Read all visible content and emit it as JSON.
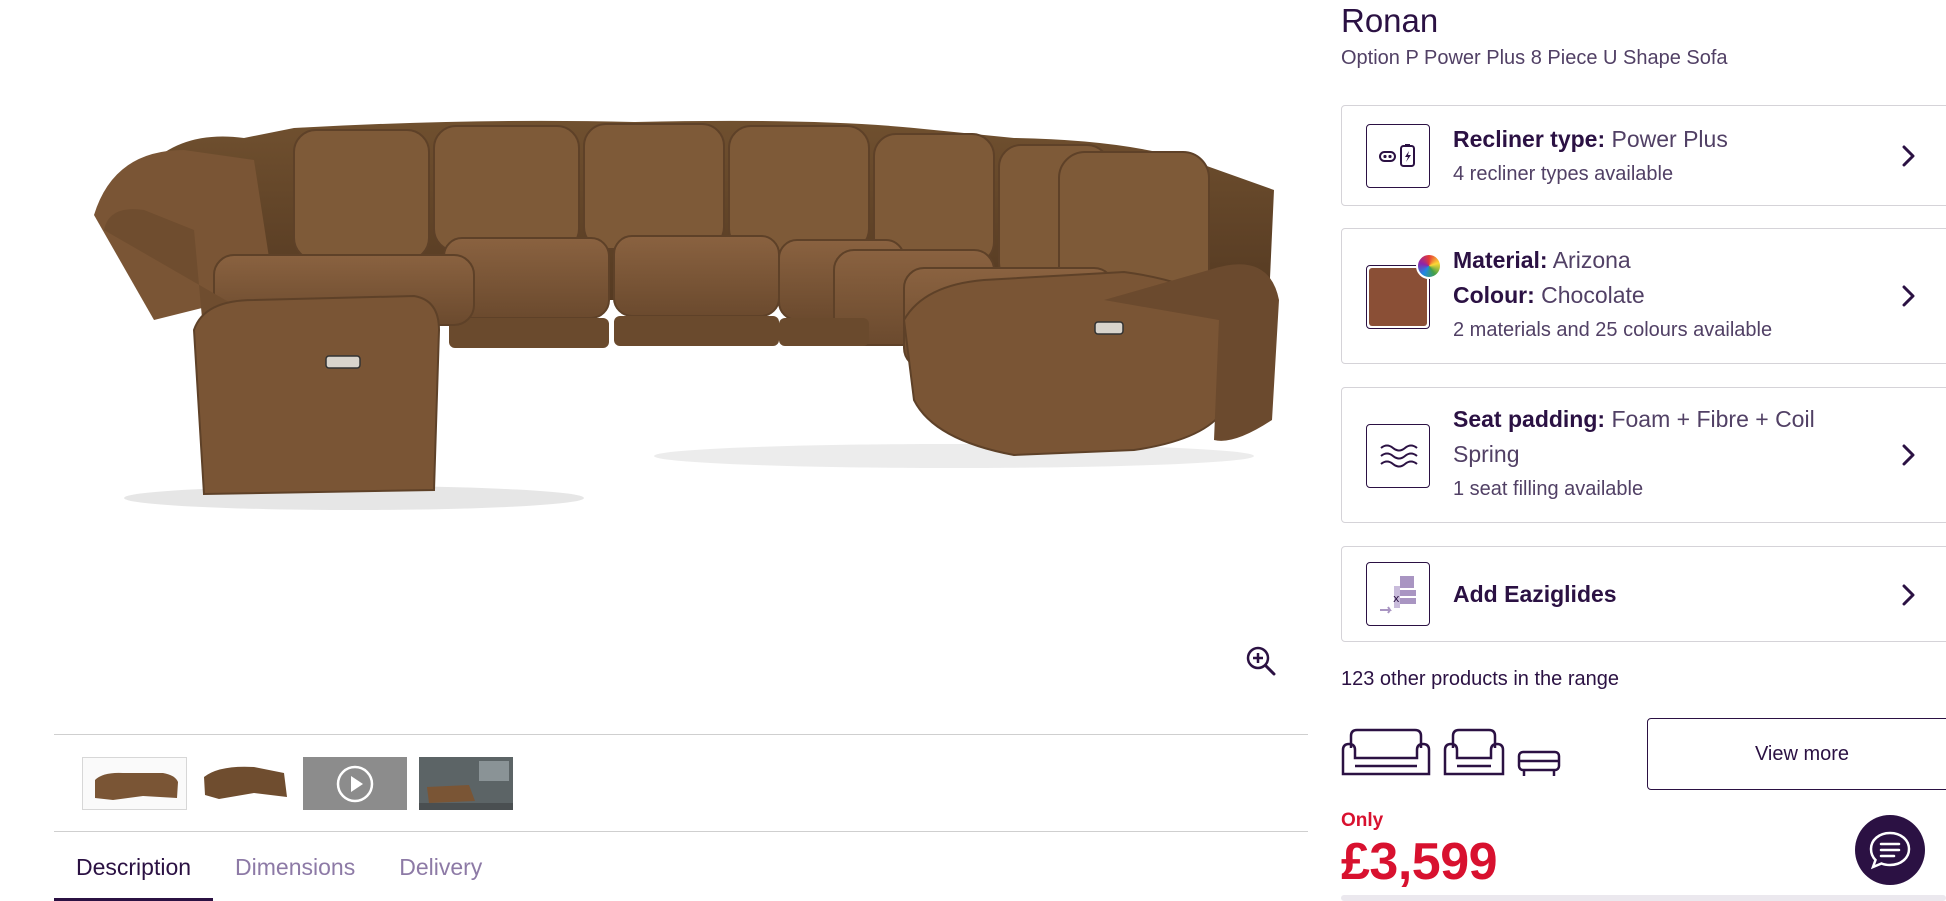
{
  "product": {
    "name": "Ronan",
    "subtitle": "Option P Power Plus 8 Piece U Shape Sofa"
  },
  "options": [
    {
      "label": "Recliner type:",
      "value": "Power Plus",
      "note": "4 recliner types available",
      "icon": "power-recliner-icon"
    },
    {
      "material_label": "Material:",
      "material_value": "Arizona",
      "colour_label": "Colour:",
      "colour_value": "Chocolate",
      "note": "2 materials and 25 colours available",
      "icon": "fabric-swatch-icon",
      "swatch_color": "#8a4f36"
    },
    {
      "label": "Seat padding:",
      "value": "Foam + Fibre + Coil Spring",
      "note": "1 seat filling available",
      "icon": "seat-padding-icon"
    },
    {
      "label": "Add Eaziglides",
      "icon": "eaziglides-icon"
    }
  ],
  "range": {
    "text": "123 other products in the range",
    "view_more_label": "View more",
    "icons": [
      "sofa-icon",
      "armchair-icon",
      "footstool-icon"
    ]
  },
  "pricing": {
    "prefix": "Only",
    "price": "£3,599",
    "color": "#d8112f"
  },
  "tabs": [
    {
      "label": "Description",
      "active": true
    },
    {
      "label": "Dimensions",
      "active": false
    },
    {
      "label": "Delivery",
      "active": false
    }
  ],
  "gallery": {
    "thumbnails": [
      "sofa-thumbnail",
      "sofa-angle-thumbnail",
      "video-thumbnail",
      "room-scene-thumbnail"
    ]
  },
  "colors": {
    "brand": "#2b1143",
    "price": "#d8112f",
    "sofa": "#7a5535"
  }
}
